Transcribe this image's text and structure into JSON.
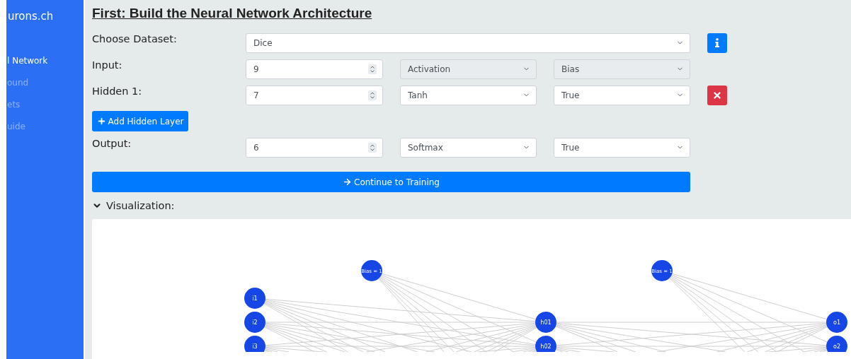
{
  "sidebar": {
    "brand": "urons.ch",
    "items": [
      {
        "label": "l Network",
        "selected": true
      },
      {
        "label": "ound",
        "selected": false
      },
      {
        "label": "ets",
        "selected": false
      },
      {
        "label": "uide",
        "selected": false
      }
    ]
  },
  "heading": "First: Build the Neural Network Architecture",
  "dataset": {
    "label": "Choose Dataset:",
    "value": "Dice"
  },
  "input_layer": {
    "label": "Input:",
    "units": "9",
    "activation": "Activation",
    "bias": "Bias",
    "disabled": true
  },
  "hidden_layers": [
    {
      "label": "Hidden 1:",
      "units": "7",
      "activation": "Tanh",
      "bias": "True",
      "disabled": false
    }
  ],
  "add_layer_button": "Add Hidden Layer",
  "output_layer": {
    "label": "Output:",
    "units": "6",
    "activation": "Softmax",
    "bias": "True",
    "disabled": false
  },
  "continue_button": "Continue to Training",
  "visualization": {
    "label": "Visualization:",
    "expanded": true,
    "columns": [
      {
        "kind": "neurons",
        "nodes": [
          "i1",
          "i2",
          "i3"
        ]
      },
      {
        "kind": "bias",
        "nodes": [
          "Bias = 1"
        ]
      },
      {
        "kind": "neurons",
        "nodes": [
          "h01",
          "h02"
        ]
      },
      {
        "kind": "bias",
        "nodes": [
          "Bias = 1"
        ]
      },
      {
        "kind": "neurons",
        "nodes": [
          "o1",
          "o2"
        ]
      }
    ]
  }
}
